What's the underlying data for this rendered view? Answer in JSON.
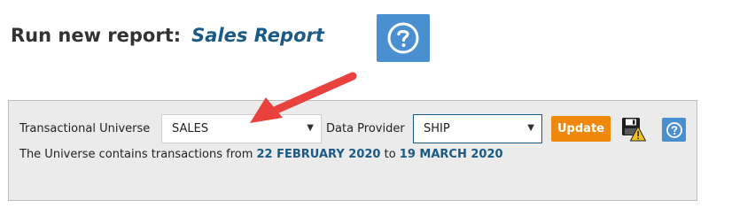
{
  "header": {
    "title_prefix": "Run new report:",
    "report_name": "Sales Report",
    "help_icon": "help-question-icon"
  },
  "form": {
    "universe_label": "Transactional Universe",
    "universe_value": "SALES",
    "provider_label": "Data Provider",
    "provider_value": "SHIP",
    "update_label": "Update",
    "info_prefix": "The Universe contains transactions from",
    "date_from": "22 FEBRUARY 2020",
    "info_middle": "to",
    "date_to": "19 MARCH 2020",
    "save_icon": "save-warning-icon",
    "help_icon": "help-question-icon"
  },
  "colors": {
    "accent_blue": "#1a5a84",
    "help_bg": "#4a90d0",
    "update_bg": "#f0890b",
    "annotation_arrow": "#e8413e",
    "panel_bg": "#ebebeb"
  }
}
